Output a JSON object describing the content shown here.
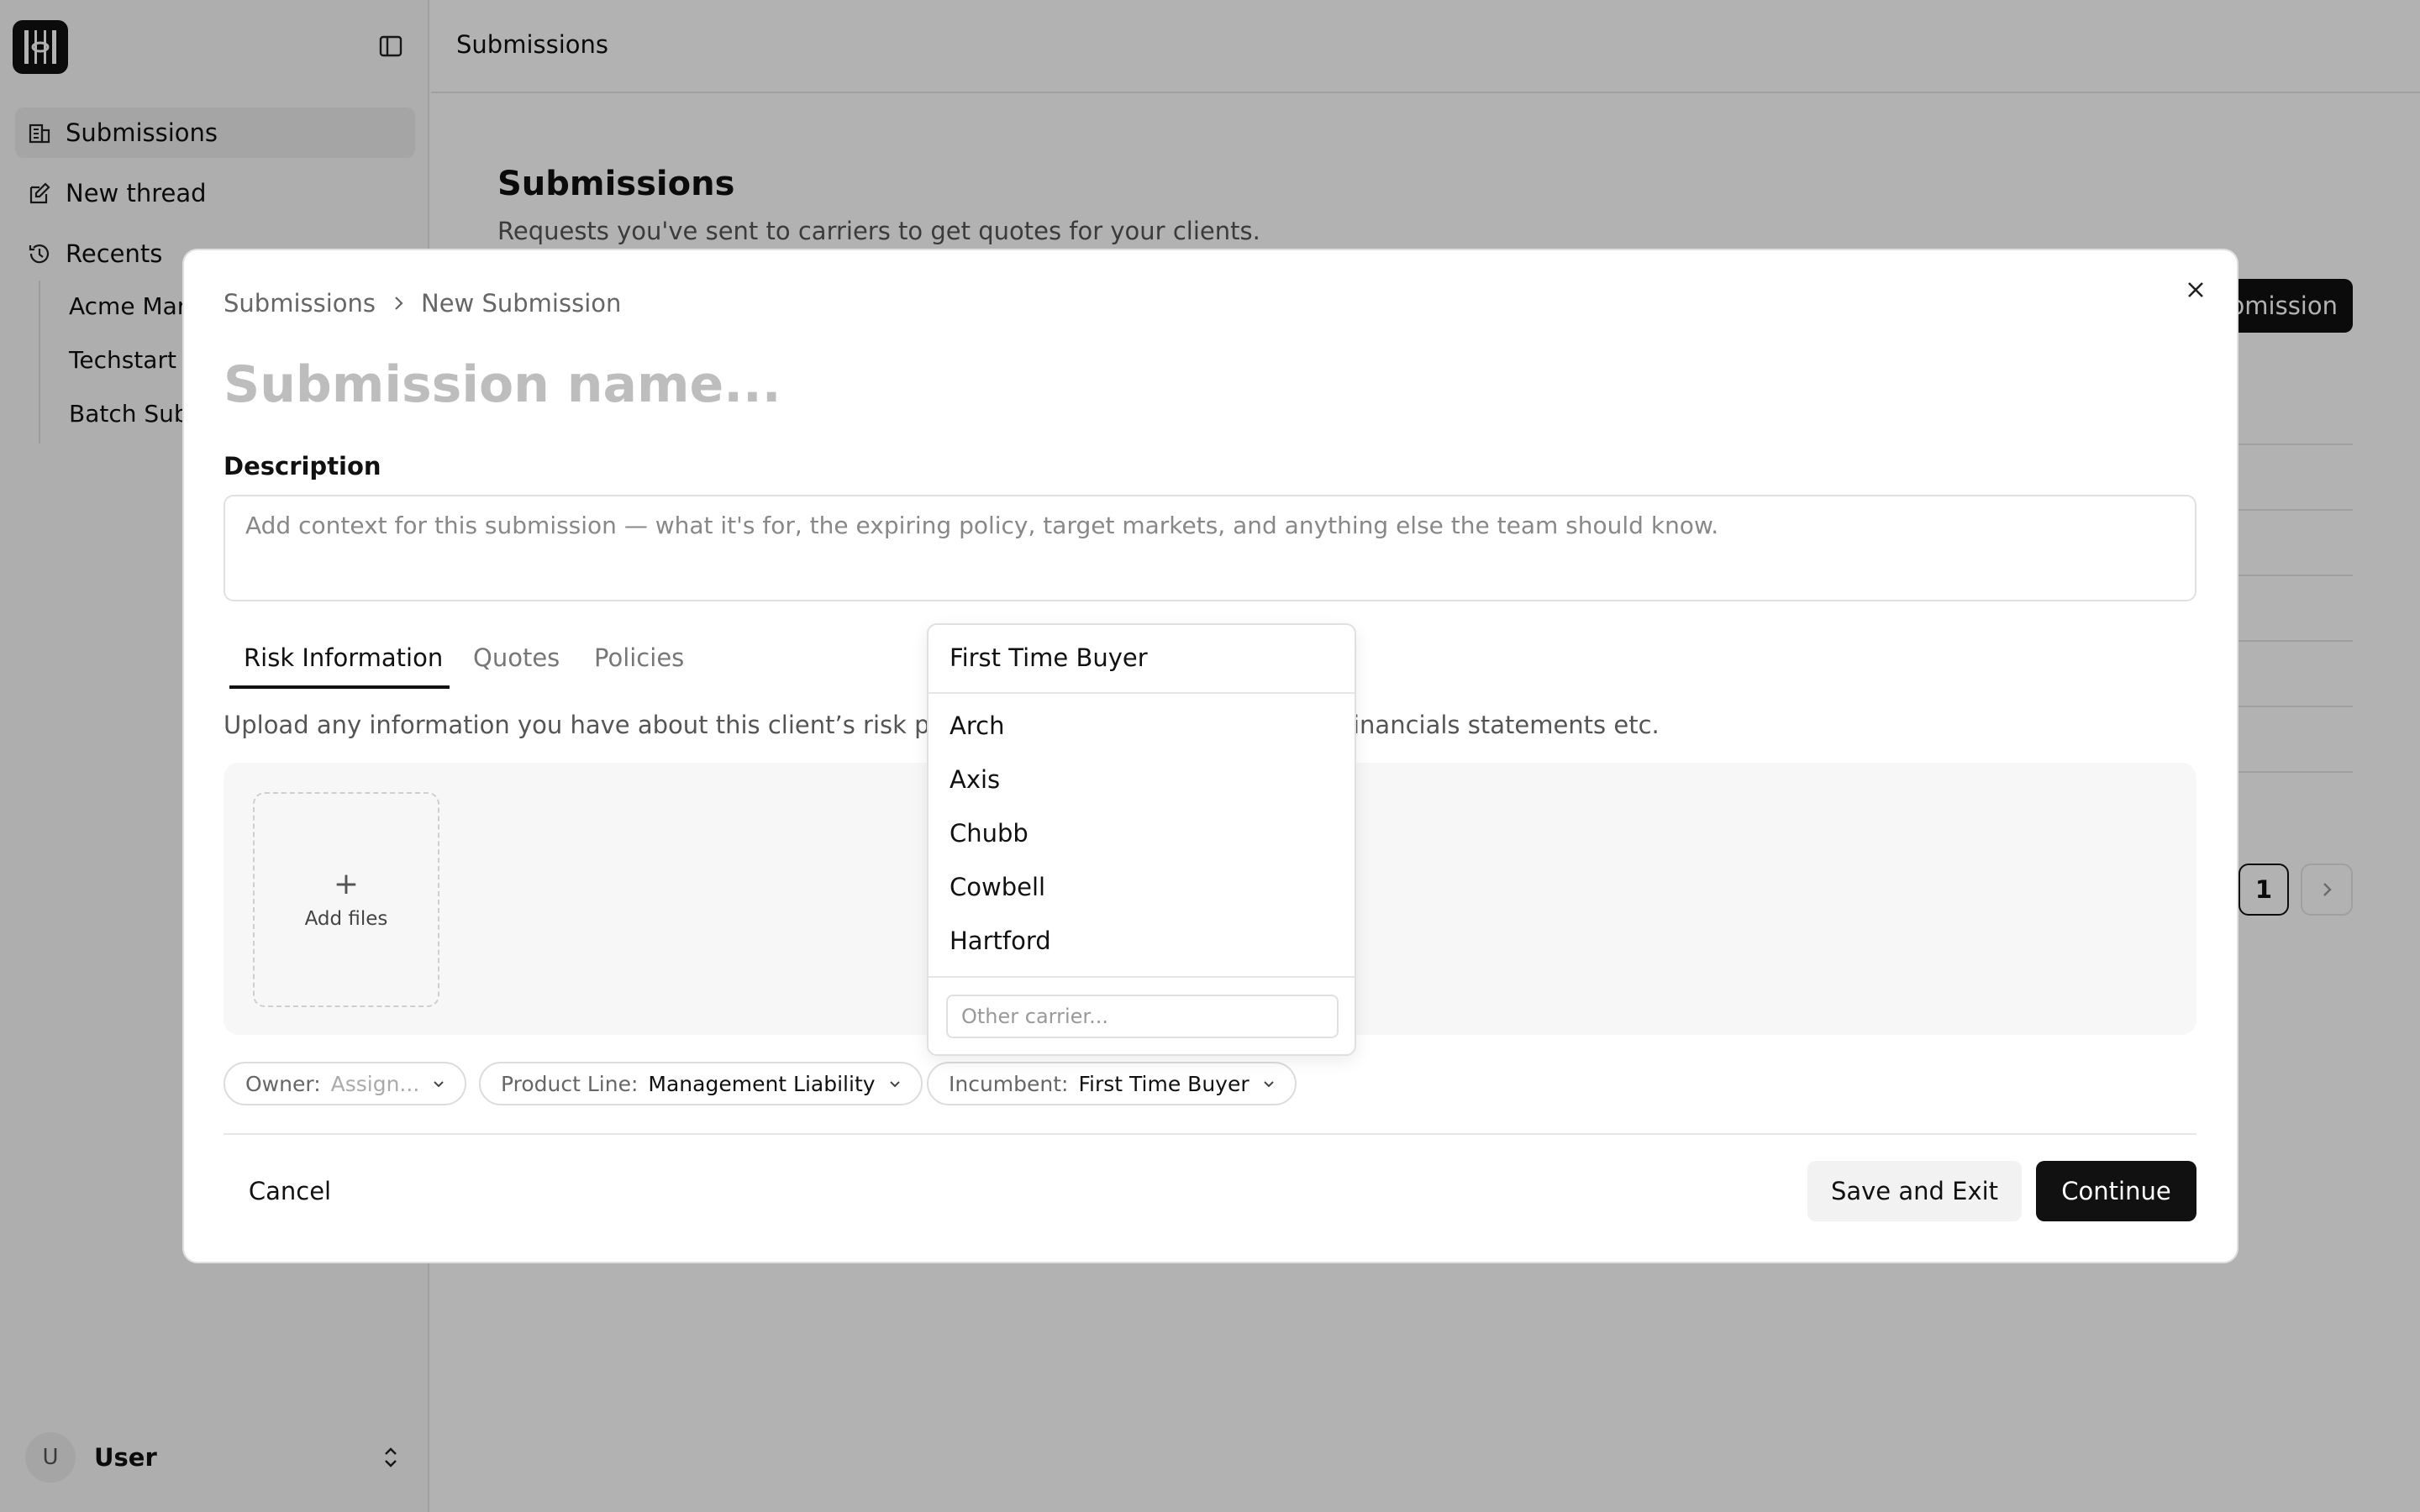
{
  "sidebar": {
    "items": [
      {
        "label": "Submissions",
        "icon": "building-icon"
      },
      {
        "label": "New thread",
        "icon": "edit-icon"
      },
      {
        "label": "Recents",
        "icon": "history-icon"
      }
    ],
    "recents": [
      "Acme Mar",
      "Techstart",
      "Batch Sub"
    ],
    "user": {
      "initial": "U",
      "name": "User"
    }
  },
  "header": {
    "title": "Submissions"
  },
  "page": {
    "title": "Submissions",
    "subtitle": "Requests you've sent to carriers to get quotes for your clients.",
    "new_button_label": "bmission",
    "pagination": {
      "current": "1"
    }
  },
  "modal": {
    "breadcrumb": [
      "Submissions",
      "New Submission"
    ],
    "name_placeholder": "Submission name...",
    "description_label": "Description",
    "description_placeholder": "Add context for this submission — what it's for, the expiring policy, target markets, and anything else the team should know.",
    "tabs": [
      {
        "label": "Risk Information",
        "active": true
      },
      {
        "label": "Quotes",
        "active": false
      },
      {
        "label": "Policies",
        "active": false
      }
    ],
    "upload_hint_left": "Upload any information you have about this client’s risk pro",
    "upload_hint_right": "inancials statements etc.",
    "add_files_label": "Add files",
    "chips": {
      "owner": {
        "key": "Owner:",
        "value": "Assign..."
      },
      "product_line": {
        "key": "Product Line:",
        "value": "Management Liability"
      },
      "incumbent": {
        "key": "Incumbent:",
        "value": "First Time Buyer"
      }
    },
    "cancel_label": "Cancel",
    "save_exit_label": "Save and Exit",
    "continue_label": "Continue"
  },
  "dropdown": {
    "selected": "First Time Buyer",
    "options": [
      "Arch",
      "Axis",
      "Chubb",
      "Cowbell",
      "Hartford"
    ],
    "other_placeholder": "Other carrier..."
  },
  "colors": {
    "primary": "#111111",
    "overlay": "rgba(0,0,0,0.30)",
    "muted_text": "#666666"
  }
}
